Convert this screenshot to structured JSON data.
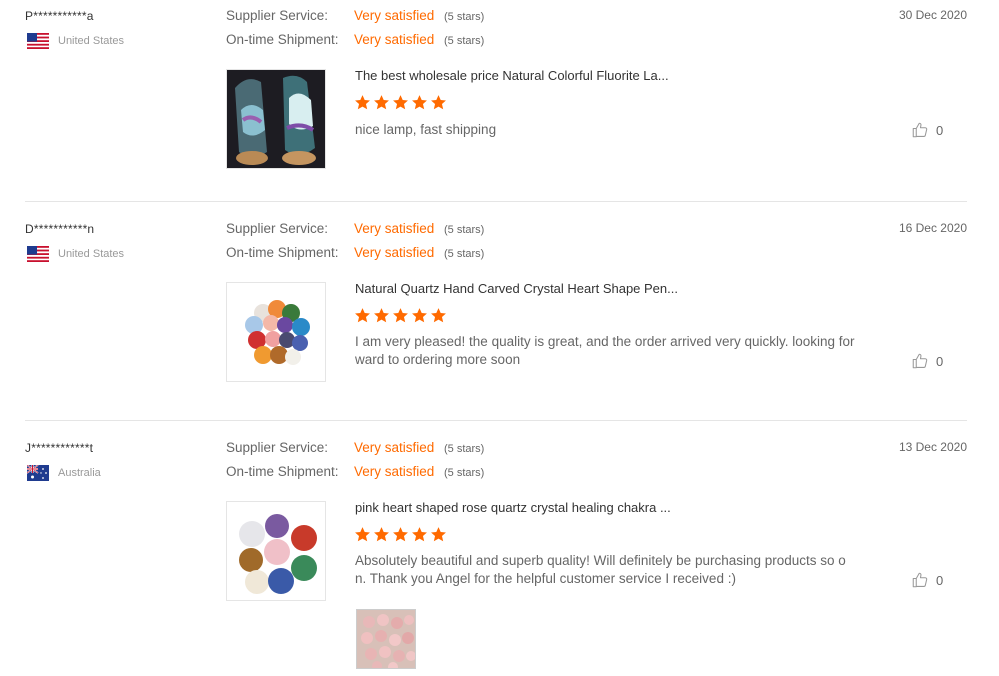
{
  "reviews": [
    {
      "buyer": "P***********a",
      "country": "United States",
      "flag_icon": "us-flag-icon",
      "supplier_label": "Supplier Service:",
      "supplier_value": "Very satisfied",
      "supplier_stars_note": "(5 stars)",
      "shipment_label": "On-time Shipment:",
      "shipment_value": "Very satisfied",
      "shipment_stars_note": "(5 stars)",
      "date": "30 Dec 2020",
      "product_title": "The best wholesale price Natural Colorful Fluorite La...",
      "rating": 5,
      "text": "nice lamp, fast shipping",
      "likes": "0"
    },
    {
      "buyer": "D***********n",
      "country": "United States",
      "flag_icon": "us-flag-icon",
      "supplier_label": "Supplier Service:",
      "supplier_value": "Very satisfied",
      "supplier_stars_note": "(5 stars)",
      "shipment_label": "On-time Shipment:",
      "shipment_value": "Very satisfied",
      "shipment_stars_note": "(5 stars)",
      "date": "16 Dec 2020",
      "product_title": "Natural Quartz Hand Carved Crystal Heart Shape Pen...",
      "rating": 5,
      "text": "I am very pleased! the quality is great, and the order arrived very quickly. looking forward to ordering more soon",
      "likes": "0"
    },
    {
      "buyer": "J************t",
      "country": "Australia",
      "flag_icon": "australia-flag-icon",
      "supplier_label": "Supplier Service:",
      "supplier_value": "Very satisfied",
      "supplier_stars_note": "(5 stars)",
      "shipment_label": "On-time Shipment:",
      "shipment_value": "Very satisfied",
      "shipment_stars_note": "(5 stars)",
      "date": "13 Dec 2020",
      "product_title": "pink heart shaped rose quartz crystal healing chakra ...",
      "rating": 5,
      "text": "Absolutely beautiful and superb quality! Will definitely be purchasing products so on. Thank you Angel for the helpful customer service I received :)",
      "likes": "0"
    }
  ],
  "colors": {
    "accent": "#ff6a00",
    "label": "#666666",
    "divider": "#e5e5e5"
  },
  "icons": {
    "star": "star-icon",
    "like": "thumbs-up-icon"
  }
}
